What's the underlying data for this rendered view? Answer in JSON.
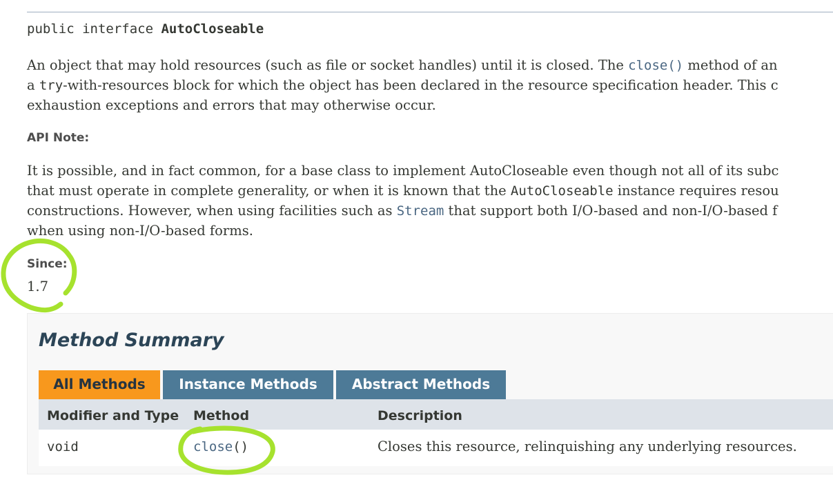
{
  "signature": {
    "prefix": "public interface ",
    "name": "AutoCloseable"
  },
  "description": {
    "line1_a": "An object that may hold resources (such as file or socket handles) until it is closed. The ",
    "line1_link": "close()",
    "line1_b": " method of an",
    "line2_code": "try",
    "line2_b": "-with-resources block for which the object has been declared in the resource specification header. This c",
    "line2_prefix": "a ",
    "line3": "exhaustion exceptions and errors that may otherwise occur."
  },
  "api_note": {
    "label": "API Note:",
    "line1": "It is possible, and in fact common, for a base class to implement AutoCloseable even though not all of its subc",
    "line2_a": "that must operate in complete generality, or when it is known that the ",
    "line2_code": "AutoCloseable",
    "line2_b": " instance requires resou",
    "line3_a": "constructions. However, when using facilities such as ",
    "line3_link": "Stream",
    "line3_b": " that support both I/O-based and non-I/O-based f",
    "line4": "when using non-I/O-based forms."
  },
  "since": {
    "label": "Since:",
    "value": "1.7"
  },
  "method_summary": {
    "title": "Method Summary",
    "tabs": [
      {
        "label": "All Methods",
        "active": true
      },
      {
        "label": "Instance Methods",
        "active": false
      },
      {
        "label": "Abstract Methods",
        "active": false
      }
    ],
    "columns": [
      "Modifier and Type",
      "Method",
      "Description"
    ],
    "rows": [
      {
        "modifier": "void",
        "method_name": "close",
        "method_parens": "()",
        "description": "Closes this resource, relinquishing any underlying resources."
      }
    ]
  },
  "colors": {
    "link": "#4a6782",
    "active_tab": "#f8981d",
    "inactive_tab": "#4d7a97",
    "table_header": "#dee3e9",
    "annotation": "#a6e22e"
  }
}
